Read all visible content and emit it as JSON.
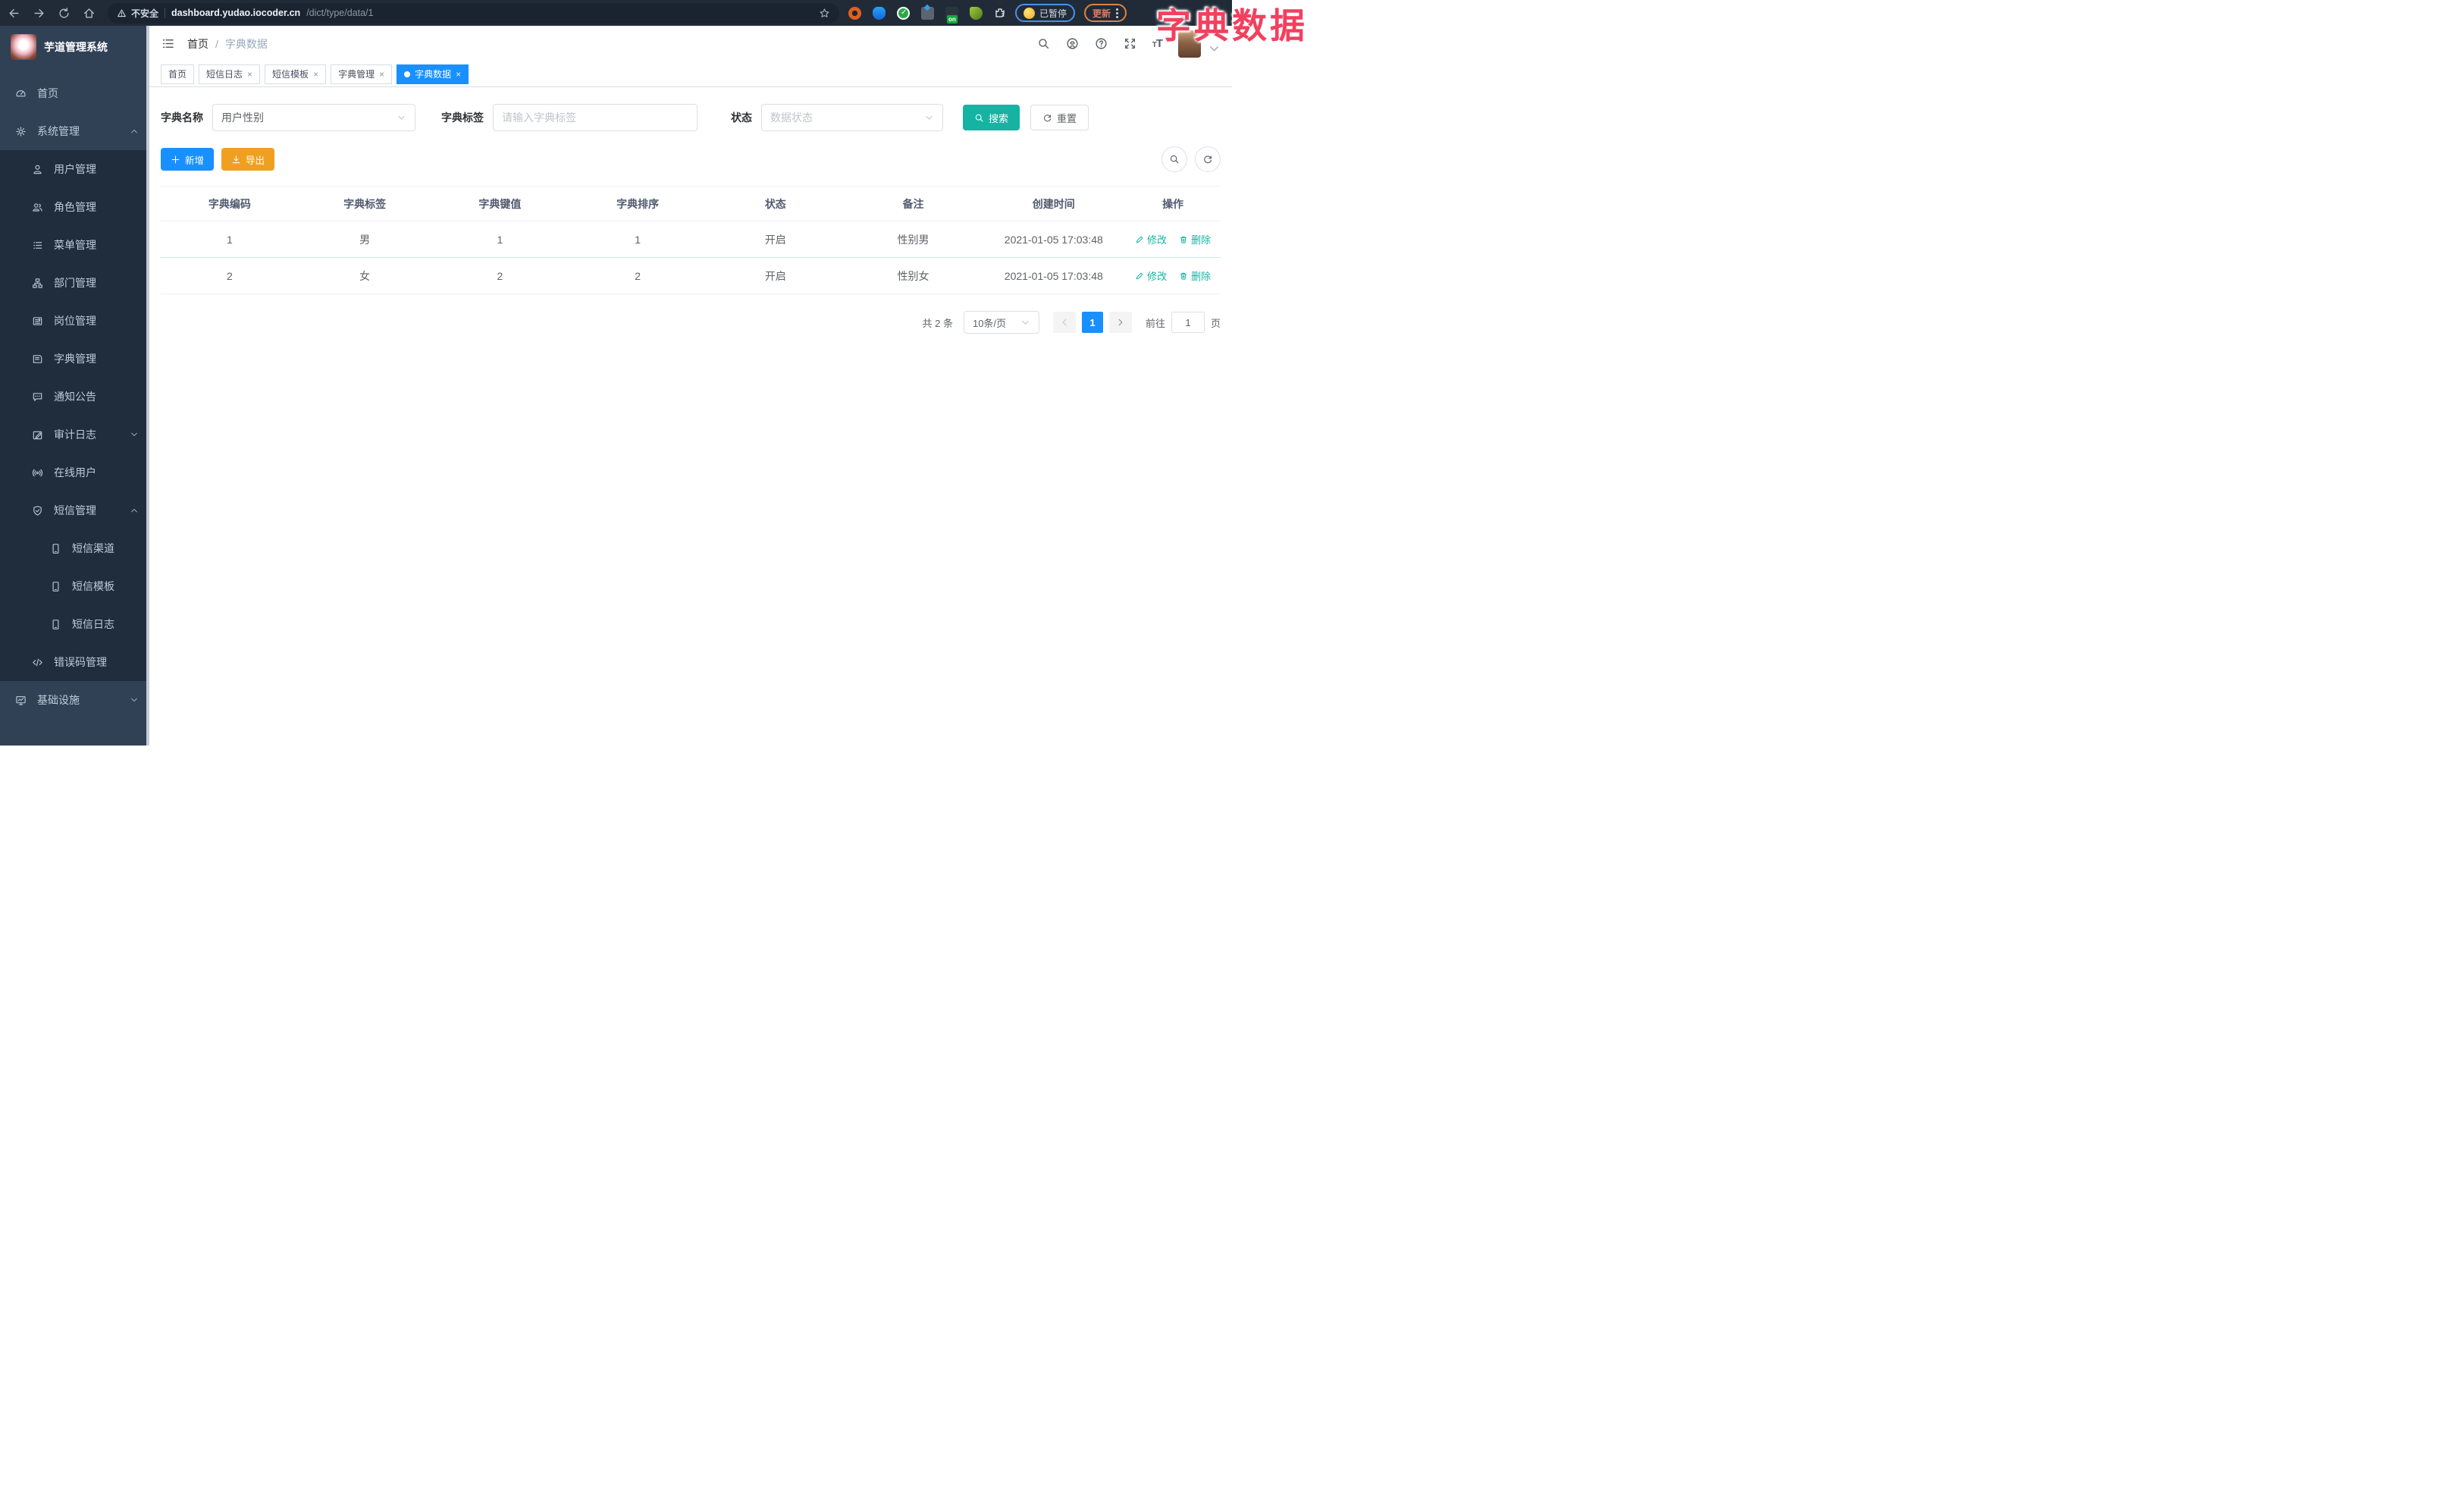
{
  "theme": {
    "primary": "#1890ff",
    "teal": "#16b3a3",
    "warning": "#f0a020",
    "title_pink": "#f2405f"
  },
  "browser": {
    "security_label": "不安全",
    "url_host": "dashboard.yudao.iocoder.cn",
    "url_path": "/dict/type/data/1",
    "extension_on_badge": "on",
    "profile_status": "已暂停",
    "update_label": "更新"
  },
  "overlay_title": "字典数据",
  "sidebar": {
    "logo_title": "芋道管理系统",
    "items": [
      {
        "label": "首页"
      },
      {
        "label": "系统管理"
      },
      {
        "label": "用户管理"
      },
      {
        "label": "角色管理"
      },
      {
        "label": "菜单管理"
      },
      {
        "label": "部门管理"
      },
      {
        "label": "岗位管理"
      },
      {
        "label": "字典管理"
      },
      {
        "label": "通知公告"
      },
      {
        "label": "审计日志"
      },
      {
        "label": "在线用户"
      },
      {
        "label": "短信管理"
      },
      {
        "label": "短信渠道"
      },
      {
        "label": "短信模板"
      },
      {
        "label": "短信日志"
      },
      {
        "label": "错误码管理"
      },
      {
        "label": "基础设施"
      }
    ]
  },
  "header": {
    "breadcrumb": {
      "home": "首页",
      "separator": "/",
      "current": "字典数据"
    }
  },
  "tabs": [
    {
      "label": "首页"
    },
    {
      "label": "短信日志"
    },
    {
      "label": "短信模板"
    },
    {
      "label": "字典管理"
    },
    {
      "label": "字典数据"
    }
  ],
  "tab_close_glyph": "×",
  "filters": {
    "dict_name_label": "字典名称",
    "dict_name_value": "用户性别",
    "dict_label_label": "字典标签",
    "dict_label_placeholder": "请输入字典标签",
    "status_label": "状态",
    "status_placeholder": "数据状态",
    "search_label": "搜索",
    "reset_label": "重置"
  },
  "toolbar": {
    "add_label": "新增",
    "export_label": "导出"
  },
  "table": {
    "columns": [
      "字典编码",
      "字典标签",
      "字典键值",
      "字典排序",
      "状态",
      "备注",
      "创建时间",
      "操作"
    ],
    "rows": [
      {
        "code": "1",
        "label": "男",
        "value": "1",
        "sort": "1",
        "status": "开启",
        "remark": "性别男",
        "created": "2021-01-05 17:03:48",
        "edit": "修改",
        "delete": "删除"
      },
      {
        "code": "2",
        "label": "女",
        "value": "2",
        "sort": "2",
        "status": "开启",
        "remark": "性别女",
        "created": "2021-01-05 17:03:48",
        "edit": "修改",
        "delete": "删除"
      }
    ]
  },
  "pagination": {
    "total": "共 2 条",
    "page_size": "10条/页",
    "current_page": "1",
    "goto_label": "前往",
    "goto_value": "1",
    "goto_unit": "页"
  }
}
